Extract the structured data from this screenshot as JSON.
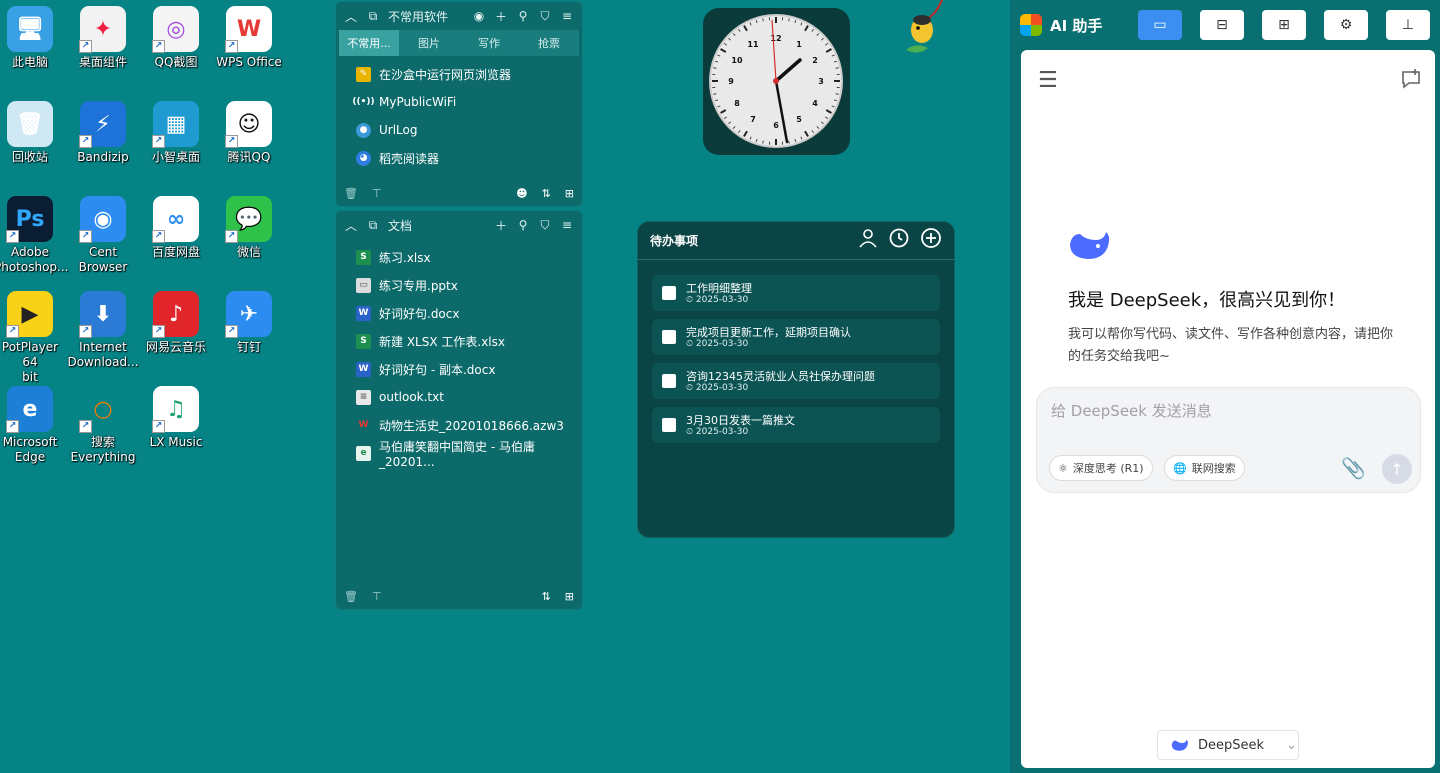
{
  "desktop": {
    "icons": [
      {
        "label": "此电脑",
        "icon": "computer-icon"
      },
      {
        "label": "桌面组件",
        "icon": "widgets-icon"
      },
      {
        "label": "QQ截图",
        "icon": "screenshot-icon"
      },
      {
        "label": "WPS Office",
        "icon": "wps-icon"
      },
      {
        "label": "回收站",
        "icon": "recycle-bin-icon"
      },
      {
        "label": "Bandizip",
        "icon": "bandizip-icon"
      },
      {
        "label": "小智桌面",
        "icon": "xiaozhi-icon"
      },
      {
        "label": "腾讯QQ",
        "icon": "qq-icon"
      },
      {
        "label": "Adobe\nPhotoshop...",
        "icon": "photoshop-icon"
      },
      {
        "label": "Cent\nBrowser",
        "icon": "cent-browser-icon"
      },
      {
        "label": "百度网盘",
        "icon": "baidu-netdisk-icon"
      },
      {
        "label": "微信",
        "icon": "wechat-icon"
      },
      {
        "label": "PotPlayer 64\nbit",
        "icon": "potplayer-icon"
      },
      {
        "label": "Internet\nDownload...",
        "icon": "idm-icon"
      },
      {
        "label": "网易云音乐",
        "icon": "netease-music-icon"
      },
      {
        "label": "钉钉",
        "icon": "dingtalk-icon"
      },
      {
        "label": "Microsoft\nEdge",
        "icon": "edge-icon"
      },
      {
        "label": "搜索\nEverything",
        "icon": "everything-icon"
      },
      {
        "label": "LX Music",
        "icon": "lx-music-icon"
      }
    ]
  },
  "fence1": {
    "title": "不常用软件",
    "tabs": [
      "不常用...",
      "图片",
      "写作",
      "抢票"
    ],
    "items": [
      "在沙盒中运行网页浏览器",
      "MyPublicWiFi",
      "UrlLog",
      "稻壳阅读器"
    ]
  },
  "fence2": {
    "title": "文档",
    "items": [
      "练习.xlsx",
      "练习专用.pptx",
      "好词好句.docx",
      "新建 XLSX 工作表.xlsx",
      "好词好句 - 副本.docx",
      "outlook.txt",
      "动物生活史_20201018666.azw3",
      "马伯庸笑翻中国简史 - 马伯庸_20201..."
    ]
  },
  "todo": {
    "title": "待办事项",
    "items": [
      {
        "text": "工作明细整理",
        "date": "2025-03-30"
      },
      {
        "text": "完成项目更新工作，延期项目确认",
        "date": "2025-03-30"
      },
      {
        "text": "咨询12345灵活就业人员社保办理问题",
        "date": "2025-03-30"
      },
      {
        "text": "3月30日发表一篇推文",
        "date": "2025-03-30"
      }
    ]
  },
  "ai": {
    "title": "AI 助手",
    "hello": "我是 DeepSeek，很高兴见到你！",
    "intro": "我可以帮你写代码、读文件、写作各种创意内容，请把你的任务交给我吧~",
    "placeholder": "给 DeepSeek 发送消息",
    "deep_think": "深度思考 (R1)",
    "web_search": "联网搜索",
    "model": "DeepSeek"
  },
  "colors": {
    "desktop": "#058385",
    "accent": "#3c8ef0",
    "deepseek": "#4d6bfe"
  }
}
